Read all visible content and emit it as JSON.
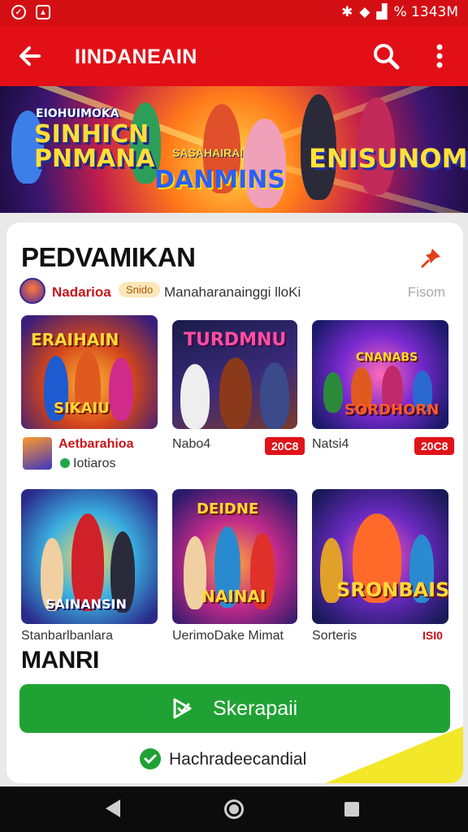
{
  "status_bar": {
    "right_text": "% 1343M"
  },
  "app_bar": {
    "title": "IINDANEAIN"
  },
  "banner": {
    "tag": "EIOHUIMOKA",
    "title_line1": "SINHICN",
    "title_line2": "PNMANA",
    "mid_small": "SASAHAIRAI",
    "mid_large": "DANMINS",
    "right": "ENISUNOMS"
  },
  "section": {
    "title": "PEDVAMIKAN",
    "developer_name": "Nadarioa",
    "developer_badge": "Snido",
    "developer_desc": "Manaharanainggi lloKi",
    "developer_link": "Fisom"
  },
  "games": [
    {
      "caption_top": "ERAIHAIN",
      "caption_bottom": "SIKAIU",
      "label": "Aetbarahioa",
      "sublabel": "Iotiaros",
      "price": ""
    },
    {
      "caption_top": "TURDMNU",
      "caption_bottom": "",
      "label": "Nabo4",
      "sublabel": "",
      "price": "20C8"
    },
    {
      "caption_top": "CNANABS",
      "caption_bottom": "SORDHORN",
      "label": "Natsi4",
      "sublabel": "",
      "price": "20C8"
    },
    {
      "caption_top": "",
      "caption_bottom": "SAINANSIN",
      "label": "Stanbarlbanlara",
      "sublabel": "",
      "price": ""
    },
    {
      "caption_top": "DEIDNE",
      "caption_bottom": "NAINAI",
      "label": "UerimoDake Mimat",
      "sublabel": "",
      "price": ""
    },
    {
      "caption_top": "",
      "caption_bottom": "SRONBAIS",
      "label": "Sorteris",
      "sublabel": "",
      "price": "ISI0"
    }
  ],
  "more_title": "MANRI",
  "install_button": {
    "label": "Skerapaii"
  },
  "bottom_note": {
    "text": "Hachradeecandial"
  },
  "colors": {
    "brand_red": "#e30f16",
    "install_green": "#1fa233",
    "price_red": "#e0131a"
  }
}
